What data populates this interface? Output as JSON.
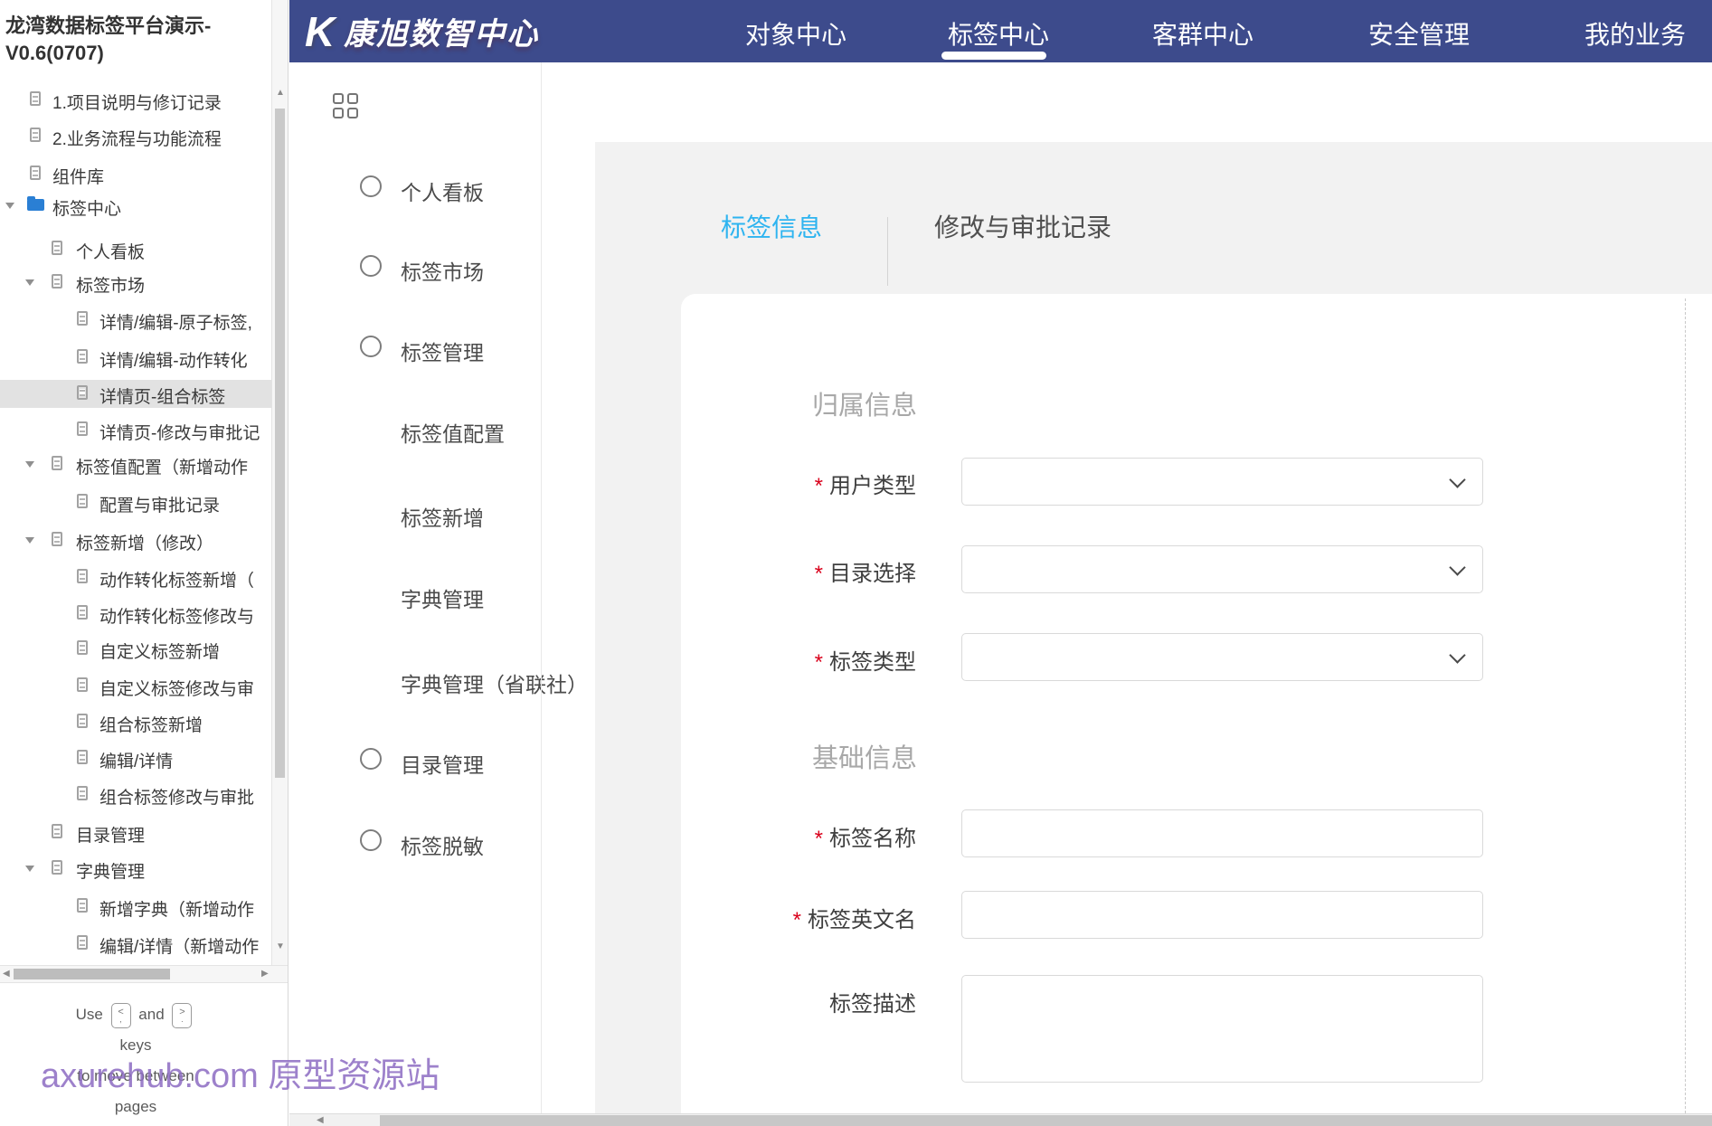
{
  "sitemap": {
    "title": "龙湾数据标签平台演示-V0.6(0707)",
    "items": [
      {
        "label": "1.项目说明与修订记录"
      },
      {
        "label": "2.业务流程与功能流程"
      },
      {
        "label": "组件库"
      },
      {
        "label": "标签中心"
      },
      {
        "label": "个人看板"
      },
      {
        "label": "标签市场"
      },
      {
        "label": "详情/编辑-原子标签,"
      },
      {
        "label": "详情/编辑-动作转化"
      },
      {
        "label": "详情页-组合标签"
      },
      {
        "label": "详情页-修改与审批记"
      },
      {
        "label": "标签值配置（新增动作"
      },
      {
        "label": "配置与审批记录"
      },
      {
        "label": "标签新增（修改）"
      },
      {
        "label": "动作转化标签新增（"
      },
      {
        "label": "动作转化标签修改与"
      },
      {
        "label": "自定义标签新增"
      },
      {
        "label": "自定义标签修改与审"
      },
      {
        "label": "组合标签新增"
      },
      {
        "label": "编辑/详情"
      },
      {
        "label": "组合标签修改与审批"
      },
      {
        "label": "目录管理"
      },
      {
        "label": "字典管理"
      },
      {
        "label": "新增字典（新增动作"
      },
      {
        "label": "编辑/详情（新增动作"
      }
    ],
    "hint": {
      "use": "Use",
      "key_left": "<",
      "key_left_sub": ",",
      "and": "and",
      "key_right": ">",
      "key_right_sub": ".",
      "line2": "keys",
      "line3": "to move between",
      "line4": "pages"
    }
  },
  "watermark": "axurehub.com 原型资源站",
  "header": {
    "logo_k": "K",
    "logo_text": "康旭数智中心",
    "nav": [
      {
        "label": "对象中心"
      },
      {
        "label": "标签中心"
      },
      {
        "label": "客群中心"
      },
      {
        "label": "安全管理"
      },
      {
        "label": "我的业务"
      }
    ],
    "colors": {
      "bar": "#3d4b8c",
      "active_tab_blue": "#2eb4f0",
      "required_red": "#d9001b"
    }
  },
  "sidebar": {
    "items": [
      {
        "label": "个人看板"
      },
      {
        "label": "标签市场"
      },
      {
        "label": "标签管理"
      },
      {
        "label": "标签值配置"
      },
      {
        "label": "标签新增"
      },
      {
        "label": "字典管理"
      },
      {
        "label": "字典管理（省联社）"
      },
      {
        "label": "目录管理"
      },
      {
        "label": "标签脱敏"
      }
    ]
  },
  "main": {
    "tabs": [
      {
        "label": "标签信息"
      },
      {
        "label": "修改与审批记录"
      }
    ],
    "form": {
      "required_mark": "*",
      "section1": "归属信息",
      "section2": "基础信息",
      "fields": {
        "user_type": "用户类型",
        "catalog": "目录选择",
        "tag_type": "标签类型",
        "tag_name": "标签名称",
        "tag_en": "标签英文名",
        "tag_desc": "标签描述"
      },
      "values": {
        "user_type": "",
        "catalog": "",
        "tag_type": "",
        "tag_name": "",
        "tag_en": "",
        "tag_desc": ""
      }
    }
  }
}
